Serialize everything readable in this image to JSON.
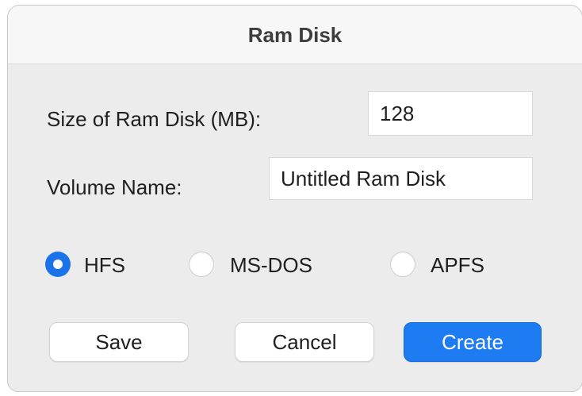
{
  "window": {
    "title": "Ram Disk"
  },
  "form": {
    "size_label": "Size of Ram Disk (MB):",
    "size_value": "128",
    "volume_label": "Volume Name:",
    "volume_value": "Untitled Ram Disk"
  },
  "format": {
    "options": [
      {
        "label": "HFS",
        "selected": true
      },
      {
        "label": "MS-DOS",
        "selected": false
      },
      {
        "label": "APFS",
        "selected": false
      }
    ]
  },
  "buttons": {
    "save": "Save",
    "cancel": "Cancel",
    "create": "Create"
  },
  "colors": {
    "accent": "#1d7cf2",
    "window_bg": "#ececec",
    "titlebar_bg": "#f7f7f7"
  }
}
